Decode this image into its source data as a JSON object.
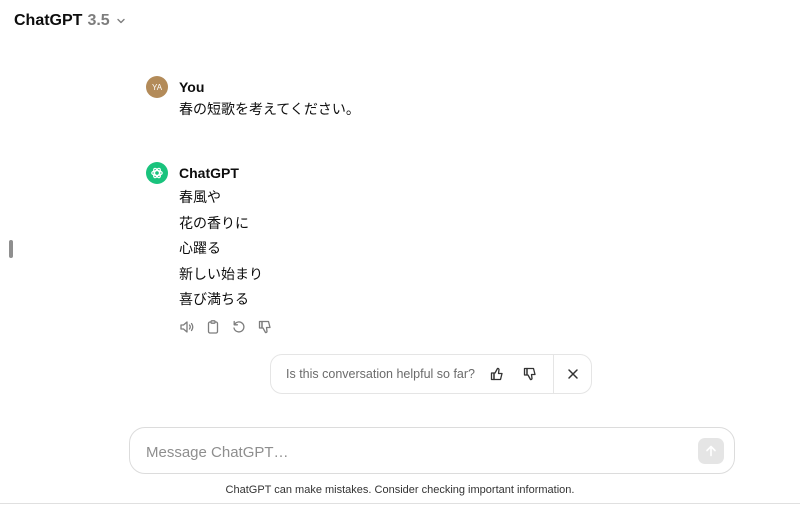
{
  "header": {
    "model_name": "ChatGPT",
    "model_version": "3.5",
    "dropdown_icon": "chevron-down-icon"
  },
  "conversation": {
    "user_message": {
      "avatar_initials": "YA",
      "author": "You",
      "text": "春の短歌を考えてください。"
    },
    "assistant_message": {
      "avatar_icon": "openai-logo-icon",
      "author": "ChatGPT",
      "lines": [
        "春風や",
        "花の香りに",
        "心躍る",
        "新しい始まり",
        "喜び満ちる"
      ],
      "actions": [
        "read-aloud-icon",
        "copy-icon",
        "regenerate-icon",
        "thumbs-down-icon"
      ]
    }
  },
  "feedback": {
    "question": "Is this conversation helpful so far?"
  },
  "composer": {
    "placeholder": "Message ChatGPT…"
  },
  "footer": {
    "disclaimer": "ChatGPT can make mistakes. Consider checking important information."
  },
  "colors": {
    "user_avatar": "#b38b59",
    "assistant_avatar": "#19c37d",
    "send_button_disabled": "#e5e5e5"
  }
}
